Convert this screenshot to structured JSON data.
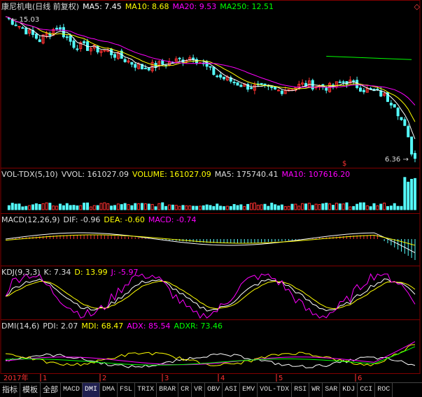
{
  "header": {
    "title": "康尼机电(日线 前复权)",
    "ma": [
      {
        "label": "MA5: 7.45",
        "color": "#ffffff"
      },
      {
        "label": "MA10: 8.68",
        "color": "#ffff00"
      },
      {
        "label": "MA20: 9.53",
        "color": "#ff00ff"
      },
      {
        "label": "MA250: 12.51",
        "color": "#00ff00"
      }
    ]
  },
  "price_labels": {
    "high": "15.03",
    "low": "6.36"
  },
  "vol_header": [
    {
      "label": "VOL-TDX(5,10)",
      "color": "#dddddd"
    },
    {
      "label": "VVOL: 161027.09",
      "color": "#dddddd"
    },
    {
      "label": "VOLUME: 161027.09",
      "color": "#ffff00"
    },
    {
      "label": "MA5: 175740.41",
      "color": "#dddddd"
    },
    {
      "label": "MA10: 107616.20",
      "color": "#ff00ff"
    }
  ],
  "macd_header": [
    {
      "label": "MACD(12,26,9)",
      "color": "#dddddd"
    },
    {
      "label": "DIF: -0.96",
      "color": "#dddddd"
    },
    {
      "label": "DEA: -0.60",
      "color": "#ffff00"
    },
    {
      "label": "MACD: -0.74",
      "color": "#ff00ff"
    }
  ],
  "kdj_header": [
    {
      "label": "KDJ(9,3,3)",
      "color": "#dddddd"
    },
    {
      "label": "K: 7.34",
      "color": "#dddddd"
    },
    {
      "label": "D: 13.99",
      "color": "#ffff00"
    },
    {
      "label": "J: -5.97",
      "color": "#ff00ff"
    }
  ],
  "dmi_header": [
    {
      "label": "DMI(14,6)",
      "color": "#dddddd"
    },
    {
      "label": "PDI: 2.07",
      "color": "#dddddd"
    },
    {
      "label": "MDI: 68.47",
      "color": "#ffff00"
    },
    {
      "label": "ADX: 85.54",
      "color": "#ff00ff"
    },
    {
      "label": "ADXR: 73.46",
      "color": "#00ff00"
    }
  ],
  "axis": {
    "year": "2017年",
    "months": [
      "1",
      "2",
      "3",
      "4",
      "5",
      "6"
    ]
  },
  "tabs": [
    "指标",
    "模板",
    "全部",
    "MACD",
    "DMI",
    "DMA",
    "FSL",
    "TRIX",
    "BRAR",
    "CR",
    "VR",
    "OBV",
    "ASI",
    "EMV",
    "VOL-TDX",
    "RSI",
    "WR",
    "SAR",
    "KDJ",
    "CCI",
    "ROC"
  ],
  "active_tab": "DMI",
  "colors": {
    "up": "#ff3232",
    "down": "#54fcfc",
    "ma250": "#00ff00",
    "grid": "#800000"
  },
  "chart_data": {
    "type": "candlestick",
    "price_range": [
      6.36,
      15.03
    ],
    "key_points": [
      {
        "day": 1,
        "price": 15.03
      },
      {
        "day": 120,
        "price": 6.36
      }
    ]
  }
}
